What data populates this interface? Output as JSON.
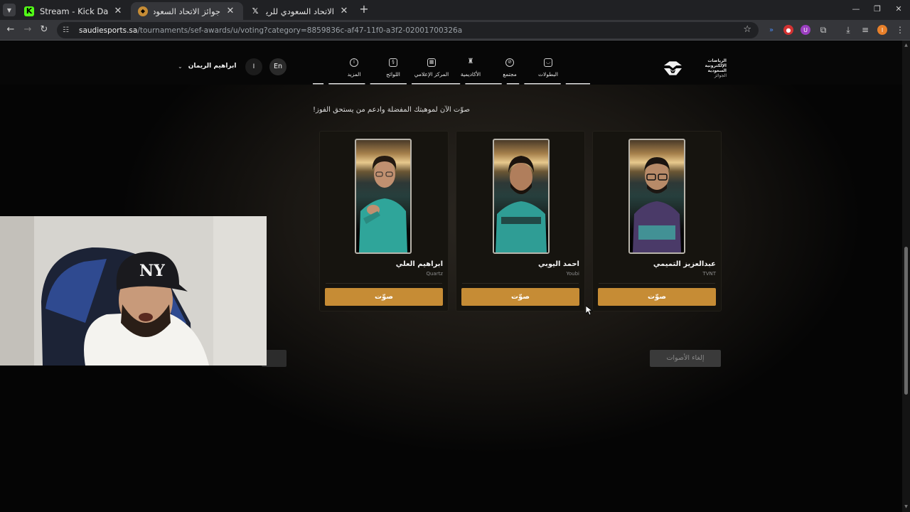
{
  "browser": {
    "tabs": [
      {
        "title": "Stream - Kick Dashboard",
        "favicon": "kick-icon",
        "active": false
      },
      {
        "title": "جوائز الاتحاد السعودي للرياضات",
        "favicon": "sef-icon",
        "active": true
      },
      {
        "title": "الاتحاد السعودي للرياضات الإلكتر",
        "favicon": "x-icon",
        "active": false
      }
    ],
    "url_host": "saudiesports.sa",
    "url_path": "/tournaments/sef-awards/u/voting?category=8859836c-af47-11f0-a3f2-02001700326a",
    "profile_initial": "I"
  },
  "site": {
    "logo_lines": [
      "الرياضات الإلكترونية",
      "السعودية",
      "الجوائز"
    ],
    "nav": [
      {
        "label": "البطولات",
        "icon": "controller-icon"
      },
      {
        "label": "مجتمع",
        "icon": "community-icon"
      },
      {
        "label": "الأكاديمية",
        "icon": "academy-icon"
      },
      {
        "label": "المركز الإعلامي",
        "icon": "media-icon"
      },
      {
        "label": "اللوائح",
        "icon": "rules-icon"
      },
      {
        "label": "المزيد",
        "icon": "more-icon"
      }
    ],
    "lang_label": "En",
    "avatar_initial": "I",
    "user_name": "ابراهيم الريمان"
  },
  "voting": {
    "subtitle": "صوّت الآن لموهبتك المفضلة وادعم من يستحق الفوز!",
    "candidates": [
      {
        "name": "عبدالعزيز التميمي",
        "team": "TVNT",
        "vote_label": "صوّت"
      },
      {
        "name": "احمد اليوبي",
        "team": "Youbi",
        "vote_label": "صوّت"
      },
      {
        "name": "ابراهيم العلي",
        "team": "Quartz",
        "vote_label": "صوّت"
      }
    ],
    "cancel_label": "إلغاء الأصوات"
  },
  "colors": {
    "accent": "#c68c35",
    "card_bg": "#16140f",
    "page_bg": "#000000"
  }
}
